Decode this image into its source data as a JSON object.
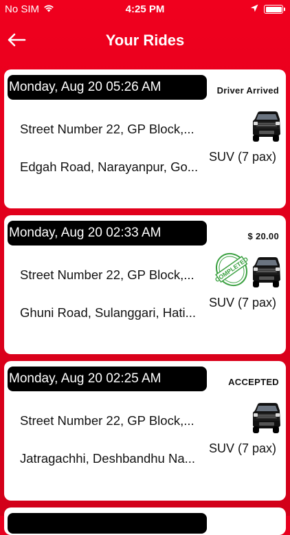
{
  "status_bar": {
    "carrier": "No SIM",
    "time": "4:25 PM"
  },
  "header": {
    "title": "Your Rides",
    "back_icon": "arrow-left-icon"
  },
  "colors": {
    "brand_red": "#e8001f",
    "card_bg": "#ffffff",
    "pill_bg": "#000000",
    "completed_green": "#3aa040"
  },
  "rides": [
    {
      "date": "Monday, Aug 20  05:26 AM",
      "status": "Driver Arrived",
      "pickup": "Street Number 22, GP Block,...",
      "dropoff": "Edgah Road, Narayanpur, Go...",
      "vehicle": "SUV (7 pax)",
      "vehicle_icon": "suv-car-icon"
    },
    {
      "date": "Monday, Aug 20  02:33 AM",
      "status": "$ 20.00",
      "pickup": "Street Number 22, GP Block,...",
      "dropoff": "Ghuni Road, Sulanggari, Hati...",
      "vehicle": "SUV (7 pax)",
      "vehicle_icon": "suv-car-icon",
      "stamp": "COMPLETED"
    },
    {
      "date": "Monday, Aug 20  02:25 AM",
      "status": "ACCEPTED",
      "pickup": "Street Number 22, GP Block,...",
      "dropoff": "Jatragachhi, Deshbandhu Na...",
      "vehicle": "SUV (7 pax)",
      "vehicle_icon": "suv-car-icon"
    }
  ]
}
